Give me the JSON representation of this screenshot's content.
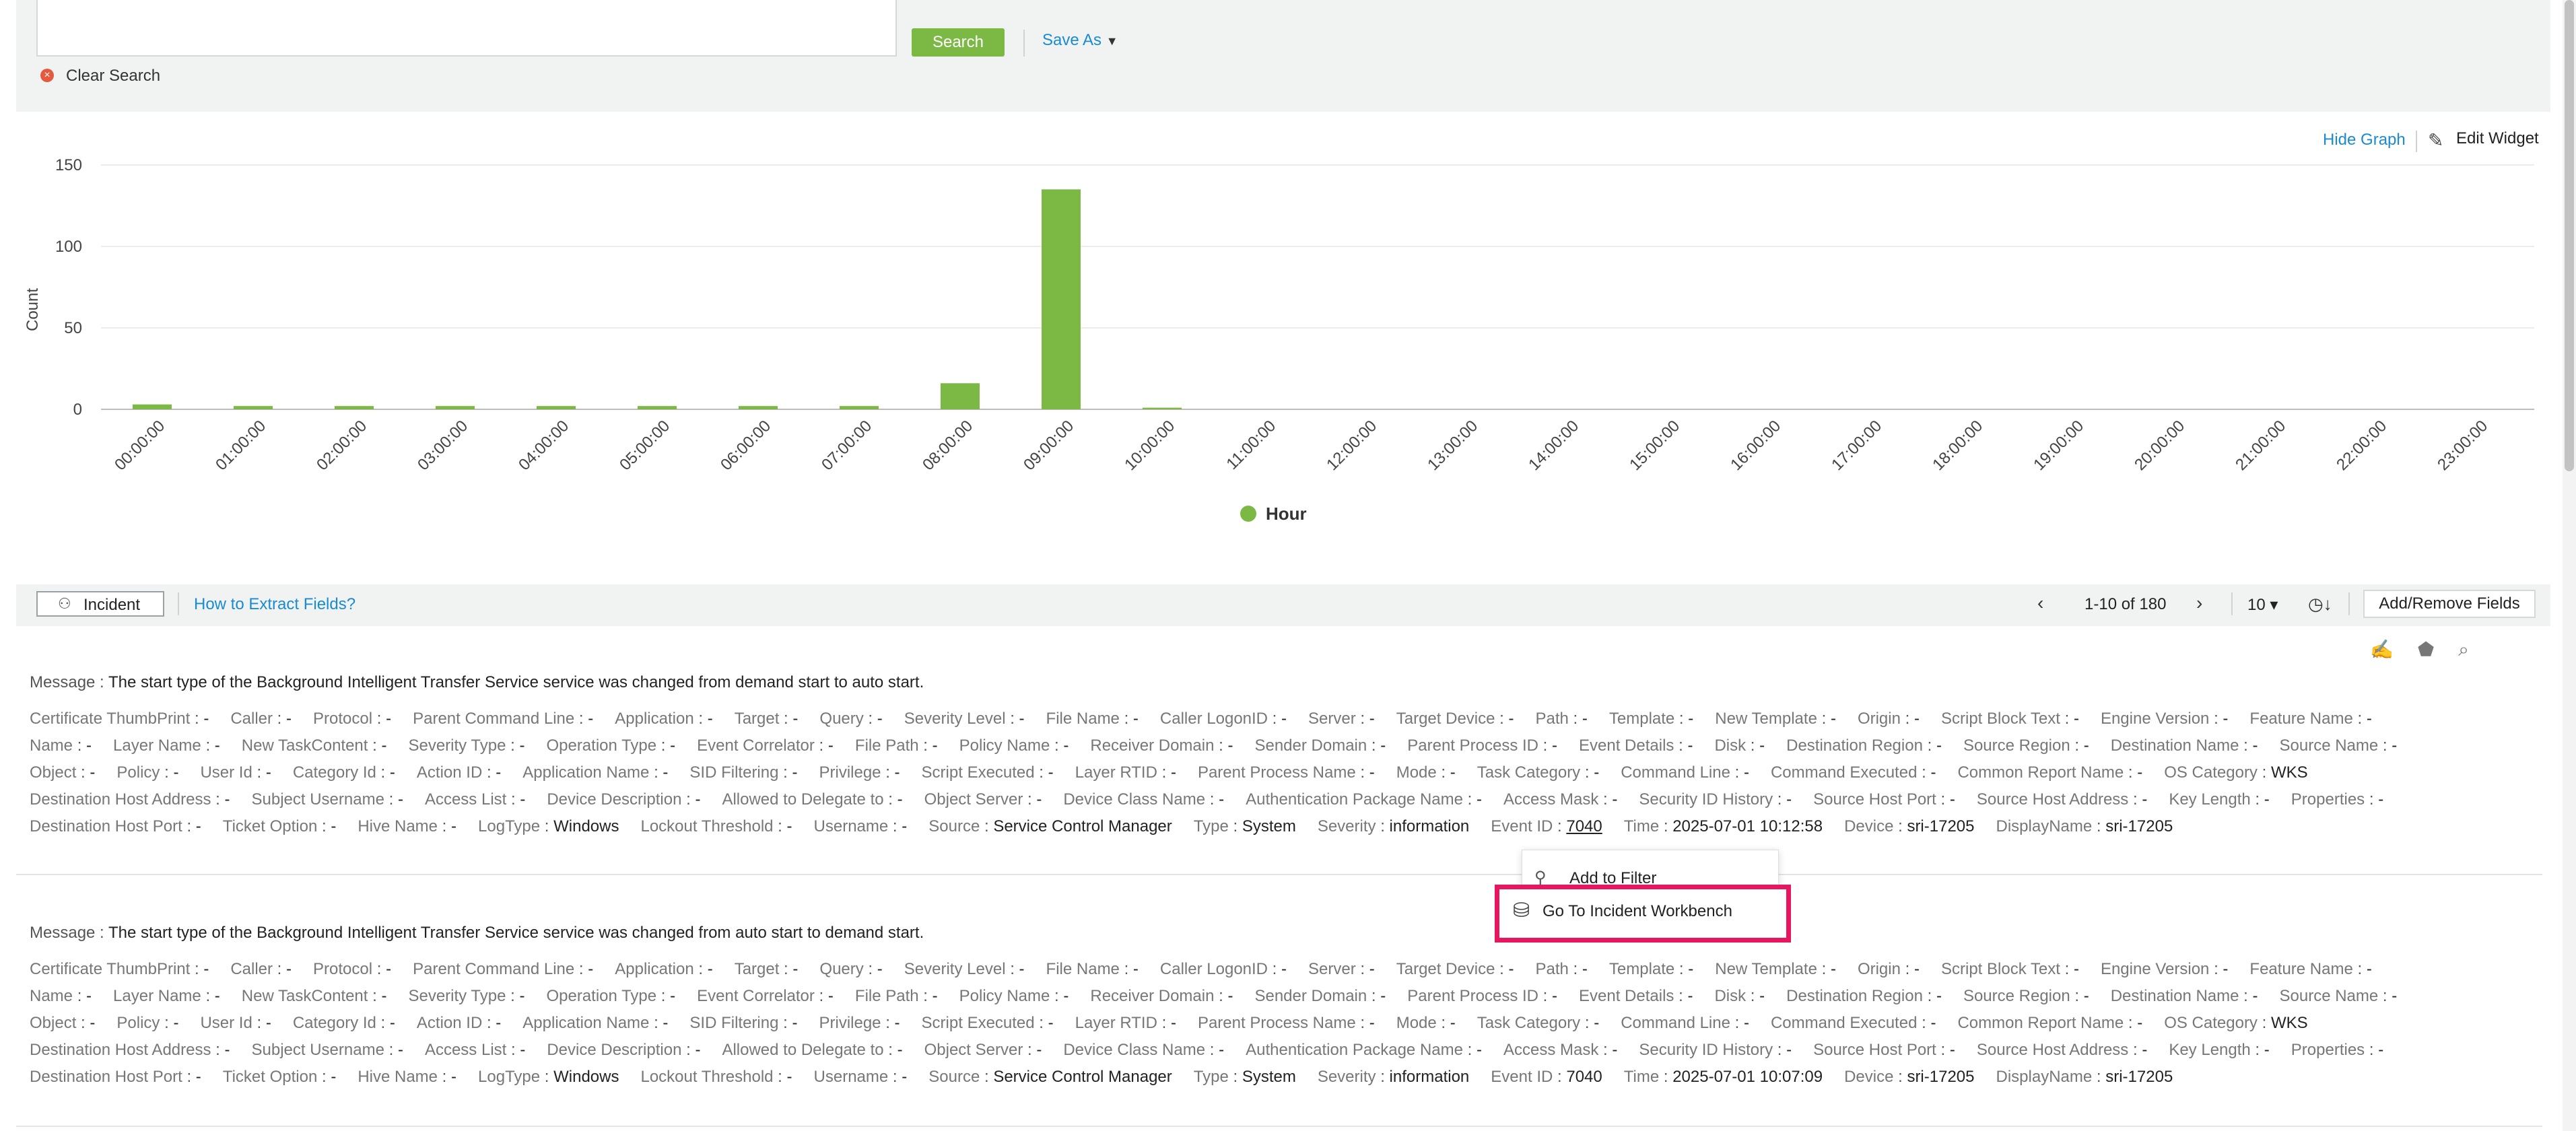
{
  "search": {
    "search_label": "Search",
    "save_as_label": "Save As",
    "clear_label": "Clear Search"
  },
  "widget": {
    "hide_graph_label": "Hide Graph",
    "edit_widget_label": "Edit Widget"
  },
  "chart_data": {
    "type": "bar",
    "categories": [
      "00:00:00",
      "01:00:00",
      "02:00:00",
      "03:00:00",
      "04:00:00",
      "05:00:00",
      "06:00:00",
      "07:00:00",
      "08:00:00",
      "09:00:00",
      "10:00:00",
      "11:00:00",
      "12:00:00",
      "13:00:00",
      "14:00:00",
      "15:00:00",
      "16:00:00",
      "17:00:00",
      "18:00:00",
      "19:00:00",
      "20:00:00",
      "21:00:00",
      "22:00:00",
      "23:00:00"
    ],
    "values": [
      3,
      2,
      2,
      2,
      2,
      2,
      2,
      2,
      16,
      135,
      1,
      0,
      0,
      0,
      0,
      0,
      0,
      0,
      0,
      0,
      0,
      0,
      0,
      0
    ],
    "ylabel": "Count",
    "yticks": [
      0,
      50,
      100,
      150
    ],
    "ylim": [
      0,
      150
    ],
    "legend": "Hour",
    "color": "#7cb944",
    "grid": true
  },
  "toolbar": {
    "incident_label": "Incident",
    "how_extract_label": "How to Extract Fields?",
    "page_info": "1-10 of 180",
    "page_size": "10 ▾",
    "add_remove_label": "Add/Remove Fields"
  },
  "records": [
    {
      "message_key": "Message",
      "message": "The start type of the Background Intelligent Transfer Service service was changed from demand start to auto start.",
      "lines": [
        [
          [
            "Certificate ThumbPrint",
            "-"
          ],
          [
            "Caller",
            "-"
          ],
          [
            "Protocol",
            "-"
          ],
          [
            "Parent Command Line",
            "-"
          ],
          [
            "Application",
            "-"
          ],
          [
            "Target",
            "-"
          ],
          [
            "Query",
            "-"
          ],
          [
            "Severity Level",
            "-"
          ],
          [
            "File Name",
            "-"
          ],
          [
            "Caller LogonID",
            "-"
          ],
          [
            "Server",
            "-"
          ],
          [
            "Target Device",
            "-"
          ],
          [
            "Path",
            "-"
          ],
          [
            "Template",
            "-"
          ],
          [
            "New Template",
            "-"
          ],
          [
            "Origin",
            "-"
          ],
          [
            "Script Block Text",
            "-"
          ],
          [
            "Engine Version",
            "-"
          ],
          [
            "Feature Name",
            "-"
          ]
        ],
        [
          [
            "Name",
            "-"
          ],
          [
            "Layer Name",
            "-"
          ],
          [
            "New TaskContent",
            "-"
          ],
          [
            "Severity Type",
            "-"
          ],
          [
            "Operation Type",
            "-"
          ],
          [
            "Event Correlator",
            "-"
          ],
          [
            "File Path",
            "-"
          ],
          [
            "Policy Name",
            "-"
          ],
          [
            "Receiver Domain",
            "-"
          ],
          [
            "Sender Domain",
            "-"
          ],
          [
            "Parent Process ID",
            "-"
          ],
          [
            "Event Details",
            "-"
          ],
          [
            "Disk",
            "-"
          ],
          [
            "Destination Region",
            "-"
          ],
          [
            "Source Region",
            "-"
          ],
          [
            "Destination Name",
            "-"
          ],
          [
            "Source Name",
            "-"
          ]
        ],
        [
          [
            "Object",
            "-"
          ],
          [
            "Policy",
            "-"
          ],
          [
            "User Id",
            "-"
          ],
          [
            "Category Id",
            "-"
          ],
          [
            "Action ID",
            "-"
          ],
          [
            "Application Name",
            "-"
          ],
          [
            "SID Filtering",
            "-"
          ],
          [
            "Privilege",
            "-"
          ],
          [
            "Script Executed",
            "-"
          ],
          [
            "Layer RTID",
            "-"
          ],
          [
            "Parent Process Name",
            "-"
          ],
          [
            "Mode",
            "-"
          ],
          [
            "Task Category",
            "-"
          ],
          [
            "Command Line",
            "-"
          ],
          [
            "Command Executed",
            "-"
          ],
          [
            "Common Report Name",
            "-"
          ],
          [
            "OS Category",
            "WKS"
          ]
        ],
        [
          [
            "Destination Host Address",
            "-"
          ],
          [
            "Subject Username",
            "-"
          ],
          [
            "Access List",
            "-"
          ],
          [
            "Device Description",
            "-"
          ],
          [
            "Allowed to Delegate to",
            "-"
          ],
          [
            "Object Server",
            "-"
          ],
          [
            "Device Class Name",
            "-"
          ],
          [
            "Authentication Package Name",
            "-"
          ],
          [
            "Access Mask",
            "-"
          ],
          [
            "Security ID History",
            "-"
          ],
          [
            "Source Host Port",
            "-"
          ],
          [
            "Source Host Address",
            "-"
          ],
          [
            "Key Length",
            "-"
          ],
          [
            "Properties",
            "-"
          ]
        ],
        [
          [
            "Destination Host Port",
            "-"
          ],
          [
            "Ticket Option",
            "-"
          ],
          [
            "Hive Name",
            "-"
          ],
          [
            "LogType",
            "Windows"
          ],
          [
            "Lockout Threshold",
            "-"
          ],
          [
            "Username",
            "-"
          ],
          [
            "Source",
            "Service Control Manager"
          ],
          [
            "Type",
            "System"
          ],
          [
            "Severity",
            "information"
          ],
          [
            "Event ID",
            "7040"
          ],
          [
            "Time",
            "2025-07-01 10:12:58"
          ],
          [
            "Device",
            "sri-17205"
          ],
          [
            "DisplayName",
            "sri-17205"
          ]
        ]
      ]
    },
    {
      "message_key": "Message",
      "message": "The start type of the Background Intelligent Transfer Service service was changed from auto start to demand start.",
      "lines": [
        [
          [
            "Certificate ThumbPrint",
            "-"
          ],
          [
            "Caller",
            "-"
          ],
          [
            "Protocol",
            "-"
          ],
          [
            "Parent Command Line",
            "-"
          ],
          [
            "Application",
            "-"
          ],
          [
            "Target",
            "-"
          ],
          [
            "Query",
            "-"
          ],
          [
            "Severity Level",
            "-"
          ],
          [
            "File Name",
            "-"
          ],
          [
            "Caller LogonID",
            "-"
          ],
          [
            "Server",
            "-"
          ],
          [
            "Target Device",
            "-"
          ],
          [
            "Path",
            "-"
          ],
          [
            "Template",
            "-"
          ],
          [
            "New Template",
            "-"
          ],
          [
            "Origin",
            "-"
          ],
          [
            "Script Block Text",
            "-"
          ],
          [
            "Engine Version",
            "-"
          ],
          [
            "Feature Name",
            "-"
          ]
        ],
        [
          [
            "Name",
            "-"
          ],
          [
            "Layer Name",
            "-"
          ],
          [
            "New TaskContent",
            "-"
          ],
          [
            "Severity Type",
            "-"
          ],
          [
            "Operation Type",
            "-"
          ],
          [
            "Event Correlator",
            "-"
          ],
          [
            "File Path",
            "-"
          ],
          [
            "Policy Name",
            "-"
          ],
          [
            "Receiver Domain",
            "-"
          ],
          [
            "Sender Domain",
            "-"
          ],
          [
            "Parent Process ID",
            "-"
          ],
          [
            "Event Details",
            "-"
          ],
          [
            "Disk",
            "-"
          ],
          [
            "Destination Region",
            "-"
          ],
          [
            "Source Region",
            "-"
          ],
          [
            "Destination Name",
            "-"
          ],
          [
            "Source Name",
            "-"
          ]
        ],
        [
          [
            "Object",
            "-"
          ],
          [
            "Policy",
            "-"
          ],
          [
            "User Id",
            "-"
          ],
          [
            "Category Id",
            "-"
          ],
          [
            "Action ID",
            "-"
          ],
          [
            "Application Name",
            "-"
          ],
          [
            "SID Filtering",
            "-"
          ],
          [
            "Privilege",
            "-"
          ],
          [
            "Script Executed",
            "-"
          ],
          [
            "Layer RTID",
            "-"
          ],
          [
            "Parent Process Name",
            "-"
          ],
          [
            "Mode",
            "-"
          ],
          [
            "Task Category",
            "-"
          ],
          [
            "Command Line",
            "-"
          ],
          [
            "Command Executed",
            "-"
          ],
          [
            "Common Report Name",
            "-"
          ],
          [
            "OS Category",
            "WKS"
          ]
        ],
        [
          [
            "Destination Host Address",
            "-"
          ],
          [
            "Subject Username",
            "-"
          ],
          [
            "Access List",
            "-"
          ],
          [
            "Device Description",
            "-"
          ],
          [
            "Allowed to Delegate to",
            "-"
          ],
          [
            "Object Server",
            "-"
          ],
          [
            "Device Class Name",
            "-"
          ],
          [
            "Authentication Package Name",
            "-"
          ],
          [
            "Access Mask",
            "-"
          ],
          [
            "Security ID History",
            "-"
          ],
          [
            "Source Host Port",
            "-"
          ],
          [
            "Source Host Address",
            "-"
          ],
          [
            "Key Length",
            "-"
          ],
          [
            "Properties",
            "-"
          ]
        ],
        [
          [
            "Destination Host Port",
            "-"
          ],
          [
            "Ticket Option",
            "-"
          ],
          [
            "Hive Name",
            "-"
          ],
          [
            "LogType",
            "Windows"
          ],
          [
            "Lockout Threshold",
            "-"
          ],
          [
            "Username",
            "-"
          ],
          [
            "Source",
            "Service Control Manager"
          ],
          [
            "Type",
            "System"
          ],
          [
            "Severity",
            "information"
          ],
          [
            "Event ID",
            "7040"
          ],
          [
            "Time",
            "2025-07-01 10:07:09"
          ],
          [
            "Device",
            "sri-17205"
          ],
          [
            "DisplayName",
            "sri-17205"
          ]
        ]
      ]
    }
  ],
  "context_menu": {
    "add_to_filter": "Add to Filter",
    "go_to_workbench": "Go To Incident Workbench"
  },
  "icons": {
    "clear": "x-circle-icon",
    "edit": "edit-widget-icon",
    "incident": "incident-icon",
    "sort": "clock-sort-icon",
    "row_actions": [
      "edit-note-icon",
      "tag-icon",
      "search-doc-icon"
    ],
    "menu": [
      "search-icon",
      "workbench-icon"
    ]
  }
}
